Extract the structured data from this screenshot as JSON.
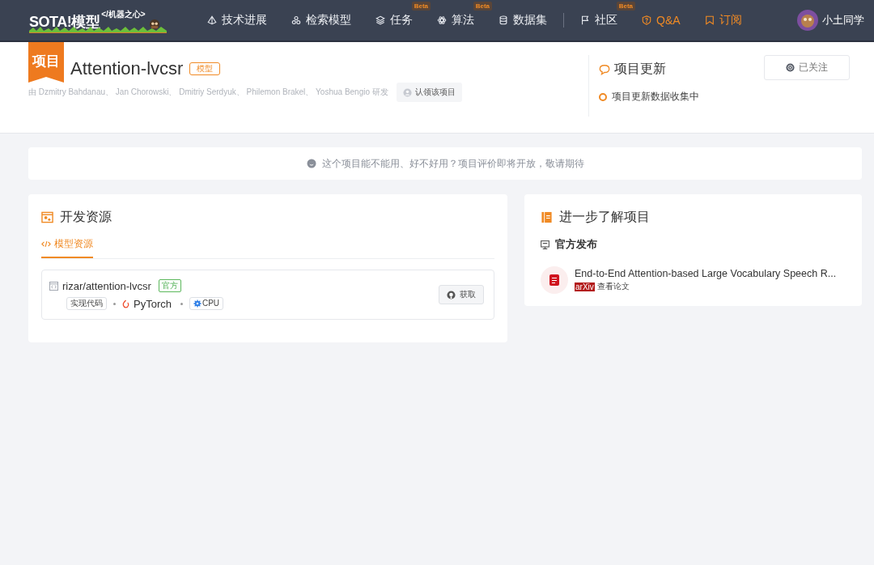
{
  "nav": {
    "logo": "SOTA!模型",
    "tagline": "</机器之心>",
    "items": [
      {
        "label": "技术进展",
        "accent": false
      },
      {
        "label": "检索模型",
        "accent": false
      },
      {
        "label": "任务",
        "badge": "Beta",
        "accent": false
      },
      {
        "label": "算法",
        "badge": "Beta",
        "accent": false
      },
      {
        "label": "数据集",
        "accent": false
      },
      {
        "label": "社区",
        "badge": "Beta",
        "accent": false
      },
      {
        "label": "Q&A",
        "accent": true
      },
      {
        "label": "订阅",
        "accent": true
      }
    ],
    "user": "小土同学"
  },
  "project": {
    "ribbon": "项目",
    "title": "Attention-lvcsr",
    "tag": "模型",
    "authors": "由 Dzmitry Bahdanau、 Jan Chorowski、 Dmitriy Serdyuk、 Philemon Brakel、 Yoshua Bengio 研发",
    "claim_button": "认领该项目"
  },
  "updates": {
    "title": "项目更新",
    "follow_button": "已关注",
    "status": "项目更新数据收集中"
  },
  "notice": "这个项目能不能用、好不好用？项目评价即将开放，敬请期待",
  "dev": {
    "title": "开发资源",
    "tabs": [
      {
        "label": "模型资源",
        "selected": true
      }
    ],
    "repos": [
      {
        "name": "rizar/attention-lvcsr",
        "official": "官方",
        "type": "实现代码",
        "framework": "PyTorch",
        "hardware": "CPU",
        "button": "获取"
      }
    ]
  },
  "more": {
    "title": "进一步了解项目",
    "section": "官方发布",
    "papers": [
      {
        "title": "End-to-End Attention-based Large Vocabulary Speech R...",
        "source": "arXiv",
        "link": "查看论文"
      }
    ]
  }
}
